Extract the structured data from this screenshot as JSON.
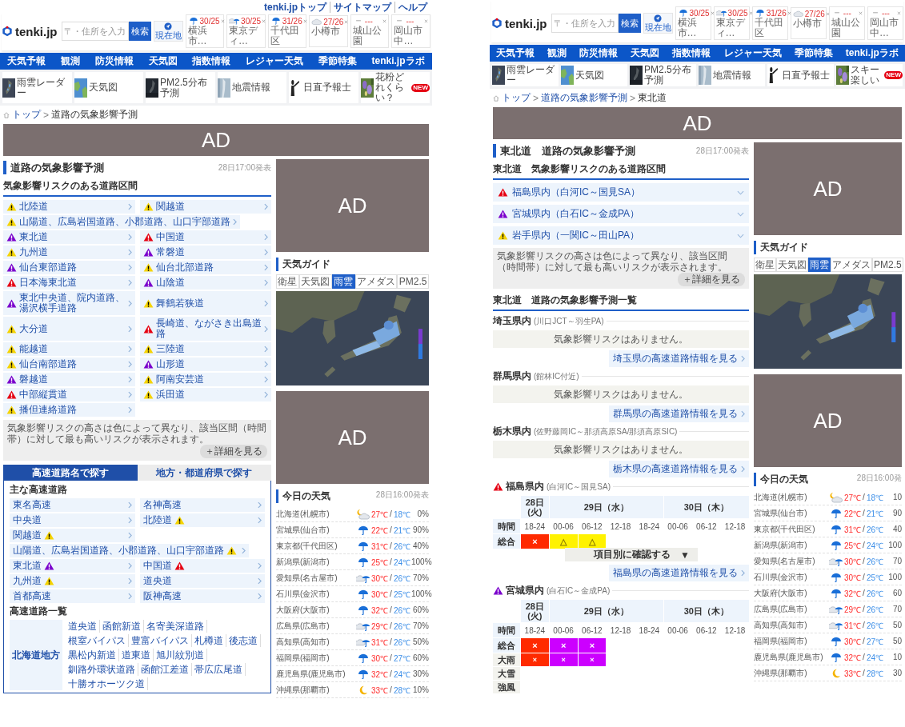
{
  "pages": [
    {
      "header": {
        "top_links": [
          "tenki.jpトップ",
          "サイトマップ",
          "ヘルプ"
        ],
        "logo": "tenki.jp",
        "search": {
          "placeholder": "〒・住所を入力",
          "button": "検索"
        },
        "location_button": "現在地",
        "favorites": [
          {
            "name": "横浜市…",
            "temps": "30/25",
            "kind": "rain"
          },
          {
            "name": "東京ディ…",
            "temps": "30/25",
            "kind": "cloud-rain"
          },
          {
            "name": "千代田区",
            "temps": "31/26",
            "kind": "rain"
          },
          {
            "name": "小樽市",
            "temps": "27/26",
            "kind": "cloud"
          },
          {
            "name": "城山公園",
            "temps": "---",
            "kind": "none"
          },
          {
            "name": "岡山市中…",
            "temps": "---",
            "kind": "none"
          }
        ]
      },
      "nav": [
        "天気予報",
        "観測",
        "防災情報",
        "天気図",
        "指数情報",
        "レジャー天気",
        "季節特集",
        "tenki.jpラボ"
      ],
      "quick_links": [
        {
          "label": "雨雲レーダー"
        },
        {
          "label": "天気図"
        },
        {
          "label": "PM2.5分布予測"
        },
        {
          "label": "地震情報"
        },
        {
          "label": "日直予報士"
        },
        {
          "label": "花粉どれくらい？",
          "badge": "NEW"
        }
      ],
      "breadcrumb": {
        "items": [
          "トップ",
          "道路の気象影響予測"
        ],
        "separator": ">"
      },
      "banner": "AD",
      "main": {
        "kind": "overview",
        "title": "道路の気象影響予測",
        "issued": "28日17:00発表",
        "risk_heading": "気象影響リスクのある道路区間",
        "road_rows": [
          [
            {
              "name": "北陸道",
              "color": "#f5d300"
            },
            {
              "name": "関越道",
              "color": "#f5d300"
            }
          ],
          [
            {
              "name": "山陽道、広島岩国道路、小郡道路、山口宇部道路",
              "color": "#f5d300"
            }
          ],
          [
            {
              "name": "東北道",
              "color": "#7a00cc"
            },
            {
              "name": "中国道",
              "color": "#e50012"
            }
          ],
          [
            {
              "name": "九州道",
              "color": "#f5d300"
            },
            {
              "name": "常磐道",
              "color": "#7a00cc"
            }
          ],
          [
            {
              "name": "仙台東部道路",
              "color": "#7a00cc"
            },
            {
              "name": "仙台北部道路",
              "color": "#f5d300"
            }
          ],
          [
            {
              "name": "日本海東北道",
              "color": "#e50012"
            },
            {
              "name": "山陰道",
              "color": "#7a00cc"
            }
          ],
          [
            {
              "name": "東北中央道、院内道路、湯沢横手道路",
              "color": "#7a00cc"
            },
            {
              "name": "舞鶴若狭道",
              "color": "#f5d300"
            }
          ],
          [
            {
              "name": "大分道",
              "color": "#f5d300"
            },
            {
              "name": "長崎道、ながさき出島道路",
              "color": "#e50012"
            }
          ],
          [
            {
              "name": "能越道",
              "color": "#f5d300"
            },
            {
              "name": "三陸道",
              "color": "#f5d300"
            }
          ],
          [
            {
              "name": "仙台南部道路",
              "color": "#f5d300"
            },
            {
              "name": "山形道",
              "color": "#7a00cc"
            }
          ],
          [
            {
              "name": "磐越道",
              "color": "#7a00cc"
            },
            {
              "name": "阿南安芸道",
              "color": "#f5d300"
            }
          ],
          [
            {
              "name": "中部縦貫道",
              "color": "#e50012"
            },
            {
              "name": "浜田道",
              "color": "#f5d300"
            }
          ],
          [
            {
              "name": "播但連絡道路",
              "color": "#f5d300"
            }
          ]
        ],
        "note": "気象影響リスクの高さは色によって異なり、該当区間（時間帯）に対して最も高いリスクが表示されます。",
        "detail_button": "＋詳細を見る",
        "search": {
          "tabs": [
            {
              "label": "高速道路名で探す",
              "selected": true
            },
            {
              "label": "地方・都道府県で探す",
              "selected": false
            }
          ],
          "major_heading": "主な高速道路",
          "major_rows": [
            [
              {
                "name": "東名高速"
              },
              {
                "name": "名神高速"
              }
            ],
            [
              {
                "name": "中央道"
              },
              {
                "name": "北陸道",
                "color": "#f5d300"
              }
            ],
            [
              {
                "name": "関越道",
                "color": "#f5d300"
              }
            ],
            [
              {
                "name": "山陽道、広島岩国道路、小郡道路、山口宇部道路",
                "color": "#f5d300"
              }
            ],
            [
              {
                "name": "東北道",
                "color": "#7a00cc"
              },
              {
                "name": "中国道",
                "color": "#e50012"
              }
            ],
            [
              {
                "name": "九州道",
                "color": "#f5d300"
              },
              {
                "name": "道央道"
              }
            ],
            [
              {
                "name": "首都高速"
              },
              {
                "name": "阪神高速"
              }
            ]
          ],
          "list_heading": "高速道路一覧",
          "regions": [
            {
              "name": "北海道地方",
              "roads": [
                "道央道",
                "函館新道",
                "名寄美深道路",
                "根室バイパス",
                "豊富バイパス",
                "札樽道",
                "後志道",
                "黒松内新道",
                "道東道",
                "旭川紋別道",
                "釧路外環状道路",
                "函館江差道",
                "帯広広尾道",
                "十勝オホーツク道"
              ]
            }
          ]
        }
      },
      "sidebar": [
        {
          "kind": "ad",
          "label": "AD"
        },
        {
          "kind": "guide",
          "title": "天気ガイド",
          "tabs": [
            {
              "label": "衛星",
              "selected": false
            },
            {
              "label": "天気図",
              "selected": false
            },
            {
              "label": "雨雲",
              "selected": true
            },
            {
              "label": "アメダス",
              "selected": false
            },
            {
              "label": "PM2.5",
              "selected": false
            }
          ]
        },
        {
          "kind": "ad",
          "label": "AD"
        },
        {
          "kind": "today",
          "title": "今日の天気",
          "issued": "28日16:00発表",
          "separator": "/",
          "rows": [
            {
              "place": "北海道(札幌市)",
              "kind": "moon-cloud",
              "high": "27℃",
              "low": "18℃",
              "pop": "0%"
            },
            {
              "place": "宮城県(仙台市)",
              "kind": "rain",
              "high": "22℃",
              "low": "21℃",
              "pop": "90%"
            },
            {
              "place": "東京都(千代田区)",
              "kind": "rain",
              "high": "31℃",
              "low": "26℃",
              "pop": "40%"
            },
            {
              "place": "新潟県(新潟市)",
              "kind": "rain",
              "high": "25℃",
              "low": "24℃",
              "pop": "100%"
            },
            {
              "place": "愛知県(名古屋市)",
              "kind": "cloud-rain",
              "high": "30℃",
              "low": "26℃",
              "pop": "70%"
            },
            {
              "place": "石川県(金沢市)",
              "kind": "rain",
              "high": "30℃",
              "low": "25℃",
              "pop": "100%"
            },
            {
              "place": "大阪府(大阪市)",
              "kind": "rain",
              "high": "32℃",
              "low": "26℃",
              "pop": "60%"
            },
            {
              "place": "広島県(広島市)",
              "kind": "cloud-rain",
              "high": "29℃",
              "low": "26℃",
              "pop": "70%"
            },
            {
              "place": "高知県(高知市)",
              "kind": "cloud-rain",
              "high": "31℃",
              "low": "26℃",
              "pop": "50%"
            },
            {
              "place": "福岡県(福岡市)",
              "kind": "rain",
              "high": "30℃",
              "low": "27℃",
              "pop": "60%"
            },
            {
              "place": "鹿児島県(鹿児島市)",
              "kind": "rain",
              "high": "32℃",
              "low": "24℃",
              "pop": "30%"
            },
            {
              "place": "沖縄県(那覇市)",
              "kind": "moon",
              "high": "33℃",
              "low": "28℃",
              "pop": "10%"
            }
          ]
        }
      ]
    },
    {
      "header": {
        "logo": "tenki.jp",
        "search": {
          "placeholder": "〒・住所を入力",
          "button": "検索"
        },
        "location_button": "現在地",
        "favorites": [
          {
            "name": "横浜市…",
            "temps": "30/25",
            "kind": "rain"
          },
          {
            "name": "東京ディ…",
            "temps": "30/25",
            "kind": "cloud-rain"
          },
          {
            "name": "千代田区",
            "temps": "31/26",
            "kind": "rain"
          },
          {
            "name": "小樽市",
            "temps": "27/26",
            "kind": "cloud"
          },
          {
            "name": "城山公園",
            "temps": "---",
            "kind": "none"
          },
          {
            "name": "岡山市中…",
            "temps": "---",
            "kind": "none"
          }
        ]
      },
      "nav": [
        "天気予報",
        "観測",
        "防災情報",
        "天気図",
        "指数情報",
        "レジャー天気",
        "季節特集",
        "tenki.jpラボ"
      ],
      "quick_links": [
        {
          "label": "雨雲レーダー"
        },
        {
          "label": "天気図"
        },
        {
          "label": "PM2.5分布予測"
        },
        {
          "label": "地震情報"
        },
        {
          "label": "日直予報士"
        },
        {
          "label": "スキー楽しい",
          "badge": "NEW"
        }
      ],
      "breadcrumb": {
        "items": [
          "トップ",
          "道路の気象影響予測",
          "東北道"
        ],
        "separator": ">"
      },
      "banner": "AD",
      "main": {
        "kind": "route",
        "title": "東北道　道路の気象影響予測",
        "issued": "28日17:00発表",
        "risk_heading": "東北道　気象影響リスクのある道路区間",
        "sections": [
          {
            "name": "福島県内（白河IC～国見SA）",
            "color": "#e50012",
            "expanded": false
          },
          {
            "name": "宮城県内（白石IC～金成PA）",
            "color": "#7a00cc",
            "expanded": false
          },
          {
            "name": "岩手県内（一関IC～田山PA）",
            "color": "#f5d300",
            "expanded": false
          }
        ],
        "note": "気象影響リスクの高さは色によって異なり、該当区間（時間帯）に対して最も高いリスクが表示されます。",
        "detail_button": "＋詳細を見る",
        "list_heading": "東北道　道路の気象影響予測一覧",
        "prefectures": [
          {
            "name": "埼玉県内",
            "range": "(川口JCT～羽生PA)",
            "message": "気象影響リスクはありません。",
            "link": "埼玉県の高速道路情報を見る"
          },
          {
            "name": "群馬県内",
            "range": "(館林IC付近)",
            "message": "気象影響リスクはありません。",
            "link": "群馬県の高速道路情報を見る"
          },
          {
            "name": "栃木県内",
            "range": "(佐野藤岡IC～那須高原SA/那須高原SIC)",
            "message": "気象影響リスクはありません。",
            "link": "栃木県の高速道路情報を見る"
          },
          {
            "name": "福島県内",
            "range": "(白河IC～国見SA)",
            "color": "#e50012",
            "link": "福島県の高速道路情報を見る",
            "table": {
              "time_label": "時間",
              "expanded": false,
              "toggle_label": "項目別に確認する",
              "toggle_icon": "▼",
              "days": [
                {
                  "label": "28日(火)",
                  "times": [
                    "18-24"
                  ]
                },
                {
                  "label": "29日（水）",
                  "times": [
                    "00-06",
                    "06-12",
                    "12-18",
                    "18-24"
                  ]
                },
                {
                  "label": "30日（木）",
                  "times": [
                    "00-06",
                    "06-12",
                    "12-18"
                  ]
                }
              ],
              "rows": [
                {
                  "label": "総合",
                  "kind": "total",
                  "cells": [
                    {
                      "mark": "×",
                      "color": "#ff2a00"
                    },
                    {
                      "mark": "△",
                      "color": "#fff200"
                    },
                    {
                      "mark": "△",
                      "color": "#fff200"
                    },
                    {},
                    {},
                    {},
                    {},
                    {}
                  ]
                }
              ]
            }
          },
          {
            "name": "宮城県内",
            "range": "(白石IC～金成PA)",
            "color": "#7a00cc",
            "table": {
              "time_label": "時間",
              "expanded": true,
              "days": [
                {
                  "label": "28日(火)",
                  "times": [
                    "18-24"
                  ]
                },
                {
                  "label": "29日（水）",
                  "times": [
                    "00-06",
                    "06-12",
                    "12-18",
                    "18-24"
                  ]
                },
                {
                  "label": "30日（木）",
                  "times": [
                    "00-06",
                    "06-12",
                    "12-18"
                  ]
                }
              ],
              "rows": [
                {
                  "label": "総合",
                  "kind": "total",
                  "cells": [
                    {
                      "mark": "×",
                      "color": "#ff2a00"
                    },
                    {
                      "mark": "×",
                      "color": "#cc00ff"
                    },
                    {
                      "mark": "×",
                      "color": "#cc00ff"
                    },
                    {},
                    {},
                    {},
                    {},
                    {}
                  ]
                },
                {
                  "label": "大雨",
                  "kind": "item",
                  "cells": [
                    {
                      "mark": "×",
                      "color": "#ff2a00"
                    },
                    {
                      "mark": "×",
                      "color": "#cc00ff"
                    },
                    {
                      "mark": "×",
                      "color": "#cc00ff"
                    },
                    {},
                    {},
                    {},
                    {},
                    {}
                  ]
                },
                {
                  "label": "大雪",
                  "kind": "item",
                  "cells": [
                    {},
                    {},
                    {},
                    {},
                    {},
                    {},
                    {},
                    {}
                  ]
                },
                {
                  "label": "強風",
                  "kind": "item",
                  "cells": [
                    {},
                    {},
                    {},
                    {},
                    {},
                    {},
                    {},
                    {}
                  ]
                }
              ]
            }
          }
        ]
      },
      "sidebar": [
        {
          "kind": "ad",
          "label": "AD"
        },
        {
          "kind": "guide",
          "title": "天気ガイド",
          "tabs": [
            {
              "label": "衛星",
              "selected": false
            },
            {
              "label": "天気図",
              "selected": false
            },
            {
              "label": "雨雲",
              "selected": true
            },
            {
              "label": "アメダス",
              "selected": false
            },
            {
              "label": "PM2.5",
              "selected": false
            }
          ]
        },
        {
          "kind": "ad",
          "label": "AD"
        },
        {
          "kind": "today",
          "title": "今日の天気",
          "issued": "28日16:00発",
          "separator": "/",
          "rows": [
            {
              "place": "北海道(札幌市)",
              "kind": "moon-cloud",
              "high": "27℃",
              "low": "18℃",
              "pop": "10"
            },
            {
              "place": "宮城県(仙台市)",
              "kind": "rain",
              "high": "22℃",
              "low": "21℃",
              "pop": "90"
            },
            {
              "place": "東京都(千代田区)",
              "kind": "rain",
              "high": "31℃",
              "low": "26℃",
              "pop": "40"
            },
            {
              "place": "新潟県(新潟市)",
              "kind": "rain",
              "high": "25℃",
              "low": "24℃",
              "pop": "100"
            },
            {
              "place": "愛知県(名古屋市)",
              "kind": "cloud-rain",
              "high": "30℃",
              "low": "26℃",
              "pop": "70"
            },
            {
              "place": "石川県(金沢市)",
              "kind": "rain",
              "high": "30℃",
              "low": "25℃",
              "pop": "100"
            },
            {
              "place": "大阪府(大阪市)",
              "kind": "rain",
              "high": "32℃",
              "low": "26℃",
              "pop": "60"
            },
            {
              "place": "広島県(広島市)",
              "kind": "cloud-rain",
              "high": "29℃",
              "low": "26℃",
              "pop": "70"
            },
            {
              "place": "高知県(高知市)",
              "kind": "cloud-rain",
              "high": "31℃",
              "low": "26℃",
              "pop": "50"
            },
            {
              "place": "福岡県(福岡市)",
              "kind": "rain",
              "high": "30℃",
              "low": "27℃",
              "pop": "50"
            },
            {
              "place": "鹿児島県(鹿児島市)",
              "kind": "rain",
              "high": "32℃",
              "low": "24℃",
              "pop": "10"
            },
            {
              "place": "沖縄県(那覇市)",
              "kind": "moon",
              "high": "33℃",
              "low": "28℃",
              "pop": "30"
            }
          ]
        }
      ]
    }
  ]
}
